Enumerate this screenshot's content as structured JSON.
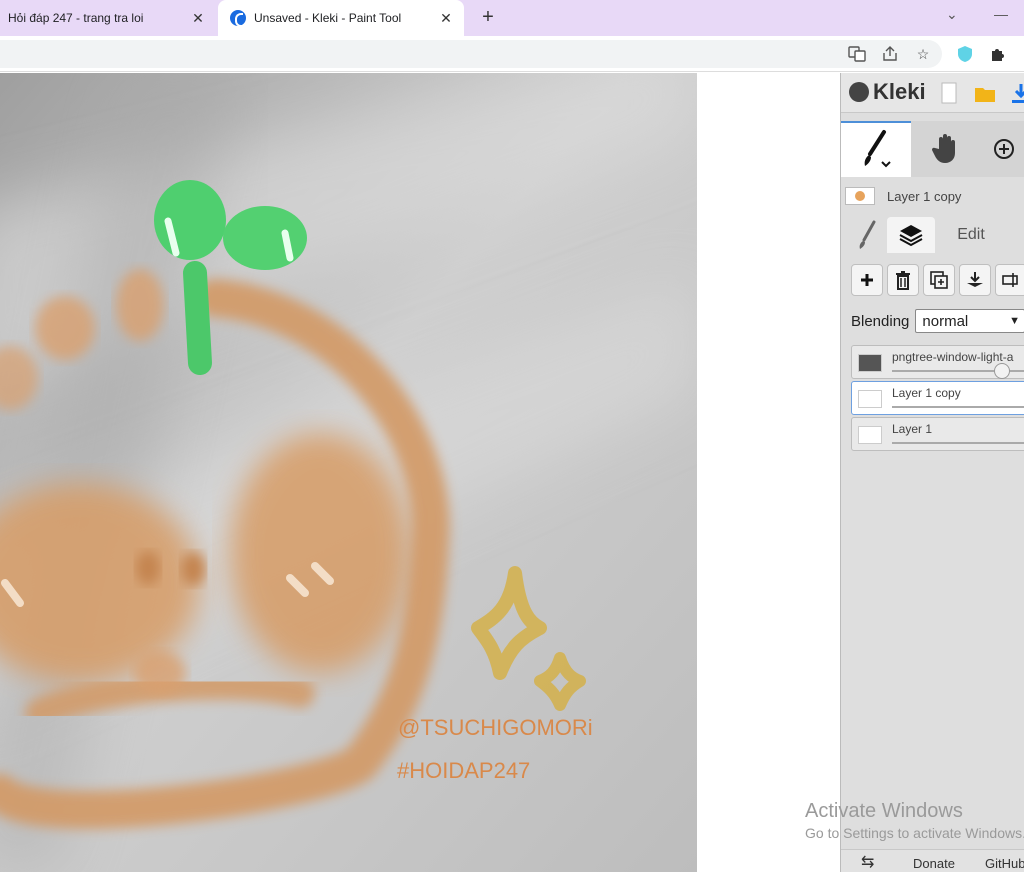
{
  "browser": {
    "tabs": [
      {
        "title": "Hỏi đáp 247 - trang tra loi",
        "active": false
      },
      {
        "title": "Unsaved - Kleki - Paint Tool",
        "active": true
      }
    ],
    "new_tab_symbol": "+",
    "close_symbol": "✕",
    "toolbar_icons": [
      "translate-icon",
      "share-icon",
      "star-icon",
      "extension-shield-icon",
      "puzzle-icon"
    ]
  },
  "canvas": {
    "watermark_line1": "@TSUCHIGOMORi",
    "watermark_line2": "#HOIDAP247",
    "watermark_color": "#d9894a"
  },
  "panel": {
    "logo_text": "Kleki",
    "current_layer_label": "Layer 1 copy",
    "tabs": [
      {
        "icon": "brush-icon"
      },
      {
        "icon": "layers-icon"
      },
      {
        "label": "Edit"
      }
    ],
    "layer_buttons": [
      "add-layer-icon",
      "delete-layer-icon",
      "duplicate-layer-icon",
      "merge-down-icon",
      "rename-layer-icon"
    ],
    "blending_label": "Blending",
    "blending_value": "normal",
    "layers": [
      {
        "name": "pngtree-window-light-a",
        "opacity": 0.75,
        "selected": false
      },
      {
        "name": "Layer 1 copy",
        "opacity": 1.0,
        "selected": true
      },
      {
        "name": "Layer 1",
        "opacity": 1.0,
        "selected": false
      }
    ],
    "footer": {
      "back_symbol": "⇆",
      "donate": "Donate",
      "github": "GitHub"
    },
    "accent_color": "#4d8fd8"
  },
  "os_overlay": {
    "line1": "Activate Windows",
    "line2": "Go to Settings to activate Windows."
  }
}
